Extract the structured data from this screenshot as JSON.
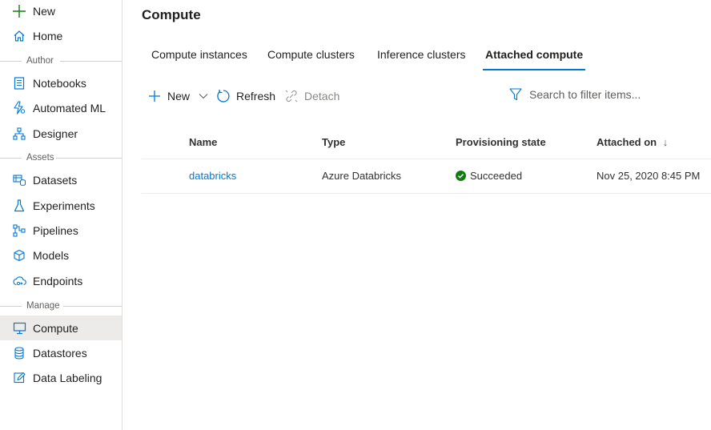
{
  "sidebar": {
    "new_label": "New",
    "home_label": "Home",
    "sections": {
      "author": "Author",
      "assets": "Assets",
      "manage": "Manage"
    },
    "items": {
      "notebooks": "Notebooks",
      "automated_ml": "Automated ML",
      "designer": "Designer",
      "datasets": "Datasets",
      "experiments": "Experiments",
      "pipelines": "Pipelines",
      "models": "Models",
      "endpoints": "Endpoints",
      "compute": "Compute",
      "datastores": "Datastores",
      "data_labeling": "Data Labeling"
    },
    "active_item": "Compute"
  },
  "page": {
    "title": "Compute"
  },
  "tabs": [
    {
      "label": "Compute instances",
      "active": false
    },
    {
      "label": "Compute clusters",
      "active": false
    },
    {
      "label": "Inference clusters",
      "active": false
    },
    {
      "label": "Attached compute",
      "active": true
    }
  ],
  "toolbar": {
    "new_label": "New",
    "refresh_label": "Refresh",
    "detach_label": "Detach",
    "search_placeholder": "Search to filter items..."
  },
  "table": {
    "columns": {
      "name": "Name",
      "type": "Type",
      "provisioning_state": "Provisioning state",
      "attached_on": "Attached on"
    },
    "sort_indicator": "↓",
    "rows": [
      {
        "name": "databricks",
        "type": "Azure Databricks",
        "provisioning_state": "Succeeded",
        "attached_on": "Nov 25, 2020 8:45 PM"
      }
    ]
  },
  "colors": {
    "accent": "#0078d4",
    "success": "#107c10",
    "new_plus": "#107c10",
    "active_bg": "#edebe9"
  }
}
